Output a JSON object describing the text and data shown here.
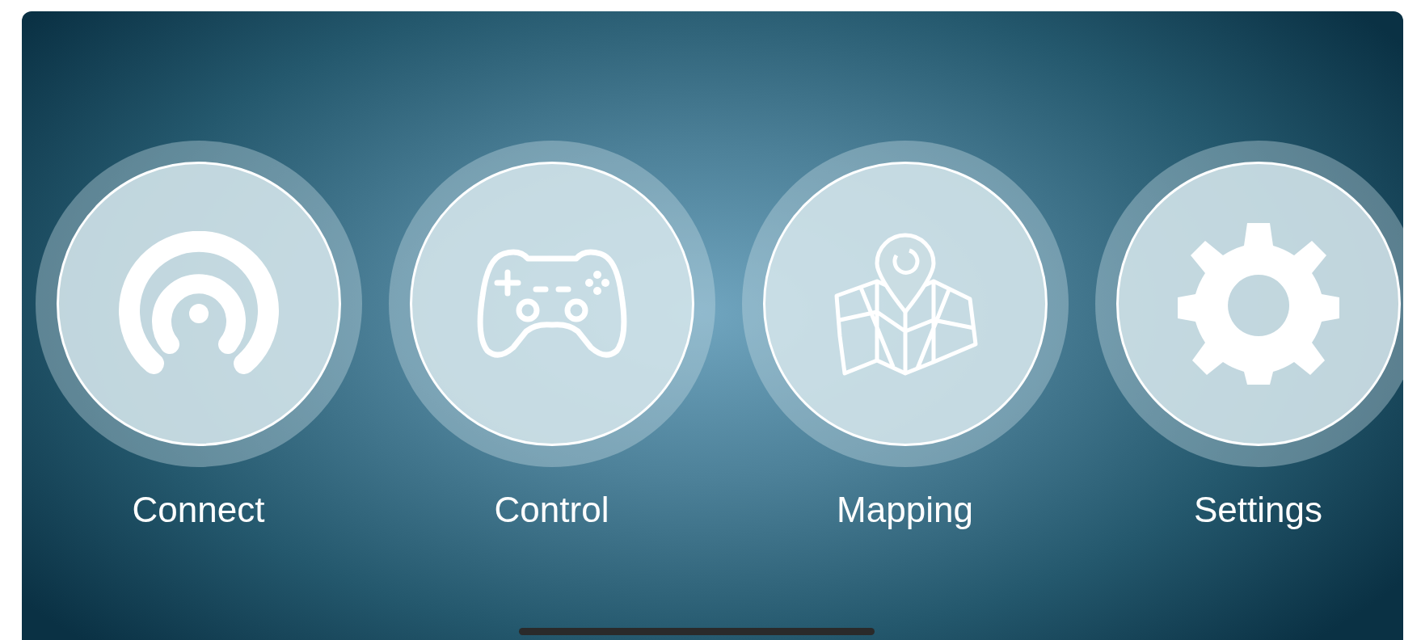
{
  "menu": [
    {
      "label": "Connect",
      "kind": "connect"
    },
    {
      "label": "Control",
      "kind": "control"
    },
    {
      "label": "Mapping",
      "kind": "mapping"
    },
    {
      "label": "Settings",
      "kind": "settings"
    }
  ]
}
